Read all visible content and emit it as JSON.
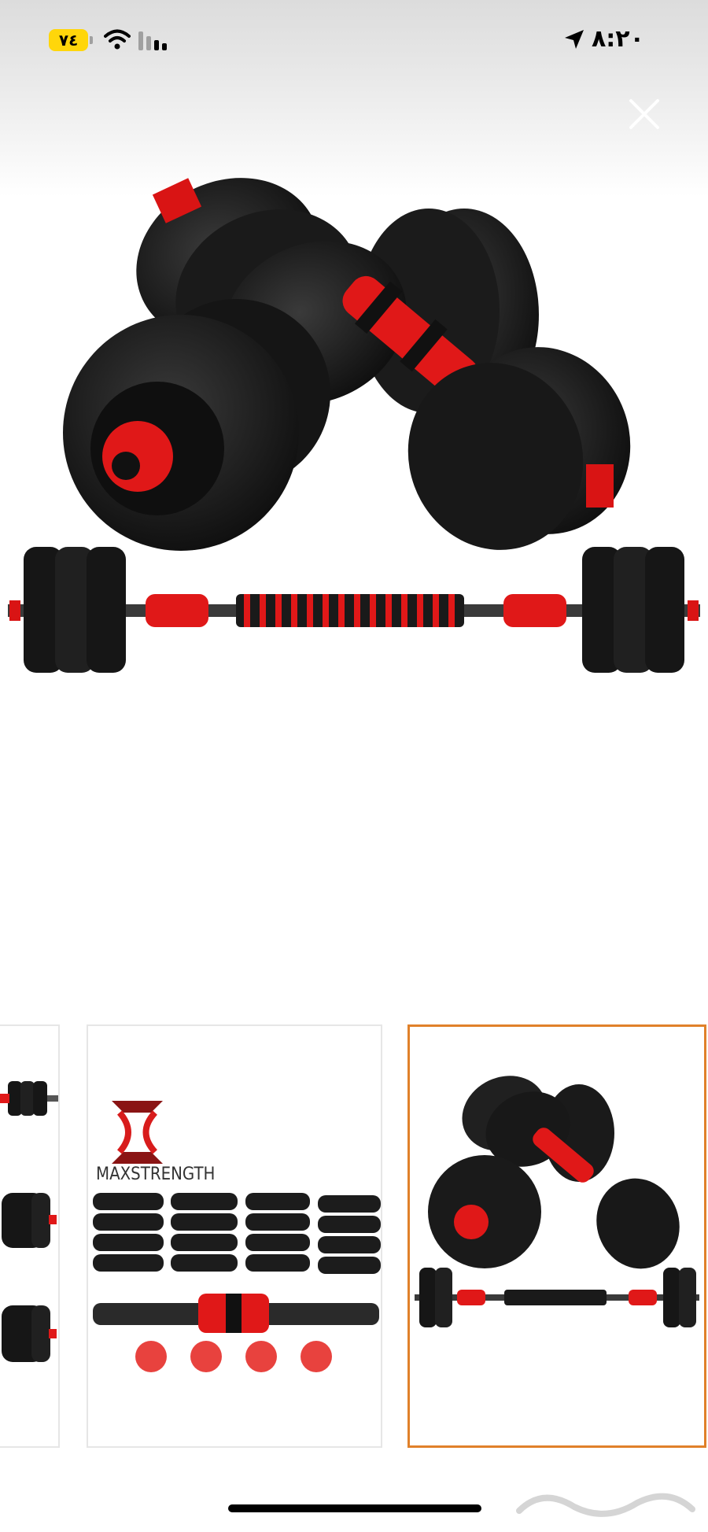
{
  "status_bar": {
    "battery_level": "٧٤",
    "time": "٨:٢٠",
    "battery_color": "#ffd60a"
  },
  "close_icon": "close-icon",
  "thumbnails": {
    "second": {
      "brand_name": "MAXSTRENGTH"
    },
    "selected_border_color": "#e0812a"
  },
  "colors": {
    "accent_red": "#e01818",
    "plate_black": "#161616"
  }
}
